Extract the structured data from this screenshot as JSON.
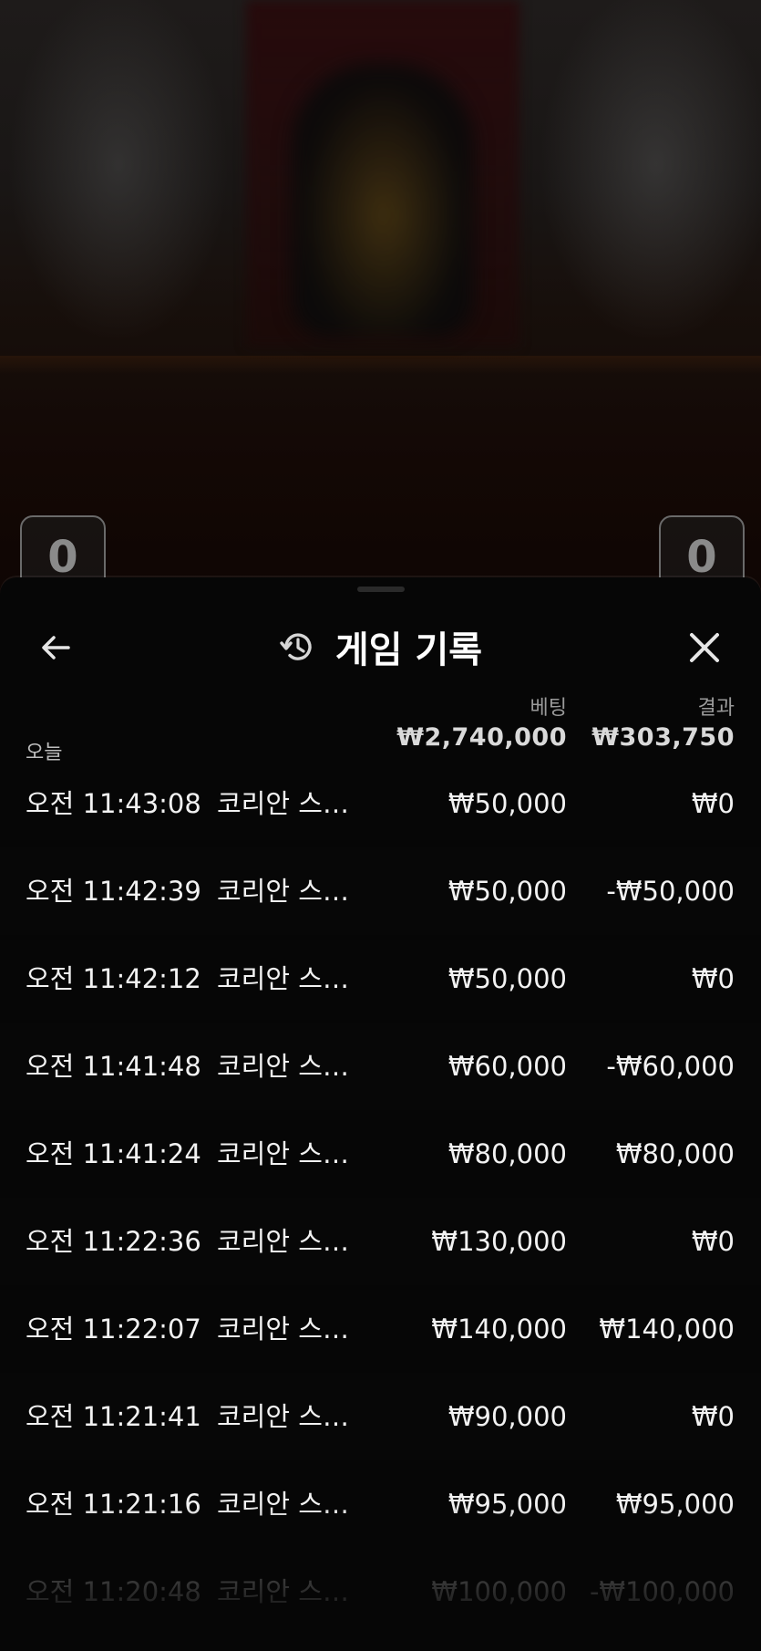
{
  "background": {
    "score_left": "0",
    "score_right": "0"
  },
  "sheet": {
    "title": "게임 기록",
    "title_icon": "history-icon",
    "back_icon": "arrow-left-icon",
    "close_icon": "close-icon",
    "columns": {
      "bet": "베팅",
      "result": "결과"
    },
    "today_label": "오늘",
    "totals": {
      "bet": "₩2,740,000",
      "result": "₩303,750"
    },
    "rows": [
      {
        "time": "오전 11:43:08",
        "game": "코리안 스피...",
        "bet": "₩50,000",
        "result": "₩0"
      },
      {
        "time": "오전 11:42:39",
        "game": "코리안 스피...",
        "bet": "₩50,000",
        "result": "-₩50,000"
      },
      {
        "time": "오전 11:42:12",
        "game": "코리안 스피...",
        "bet": "₩50,000",
        "result": "₩0"
      },
      {
        "time": "오전 11:41:48",
        "game": "코리안 스피...",
        "bet": "₩60,000",
        "result": "-₩60,000"
      },
      {
        "time": "오전 11:41:24",
        "game": "코리안 스피...",
        "bet": "₩80,000",
        "result": "₩80,000"
      },
      {
        "time": "오전 11:22:36",
        "game": "코리안 스피...",
        "bet": "₩130,000",
        "result": "₩0"
      },
      {
        "time": "오전 11:22:07",
        "game": "코리안 스피...",
        "bet": "₩140,000",
        "result": "₩140,000"
      },
      {
        "time": "오전 11:21:41",
        "game": "코리안 스피...",
        "bet": "₩90,000",
        "result": "₩0"
      },
      {
        "time": "오전 11:21:16",
        "game": "코리안 스피...",
        "bet": "₩95,000",
        "result": "₩95,000"
      },
      {
        "time": "오전 11:20:48",
        "game": "코리안 스피...",
        "bet": "₩100,000",
        "result": "-₩100,000"
      }
    ]
  },
  "colors": {
    "sheet_bg": "#060606",
    "text_primary": "#f2f2f2",
    "text_secondary": "#9a9a9a"
  }
}
